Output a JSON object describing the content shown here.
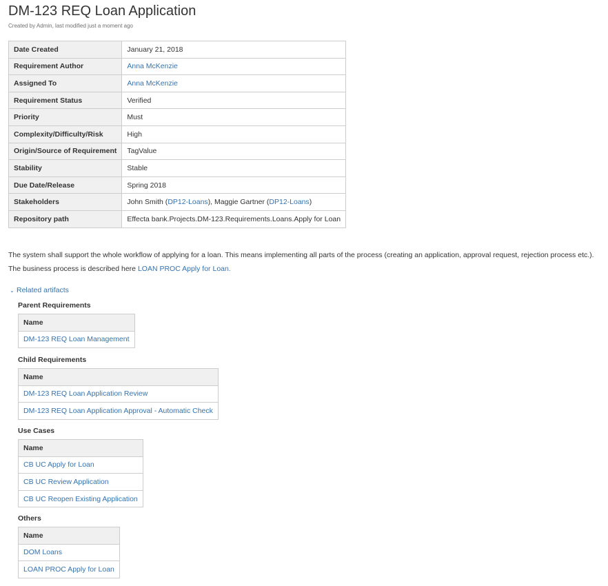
{
  "page": {
    "title": "DM-123 REQ Loan Application",
    "byline": "Created by Admin, last modified just a moment ago"
  },
  "properties": [
    {
      "label": "Date Created",
      "value": "January 21, 2018"
    },
    {
      "label": "Requirement Author",
      "value": "Anna McKenzie"
    },
    {
      "label": "Assigned To",
      "value": "Anna McKenzie"
    },
    {
      "label": "Requirement Status",
      "value": "Verified"
    },
    {
      "label": "Priority",
      "value": "Must"
    },
    {
      "label": "Complexity/Difficulty/Risk",
      "value": "High"
    },
    {
      "label": "Origin/Source of Requirement",
      "value": "TagValue"
    },
    {
      "label": "Stability",
      "value": "Stable"
    },
    {
      "label": "Due Date/Release",
      "value": "Spring 2018"
    },
    {
      "label": "Stakeholders",
      "value": ""
    },
    {
      "label": "Repository path",
      "value": "Effecta bank.Projects.DM-123.Requirements.Loans.Apply for Loan"
    }
  ],
  "stakeholders": {
    "person1": "John Smith",
    "person1_group": "DP12-Loans",
    "person2": "Maggie Gartner",
    "person2_group": "DP12-Loans"
  },
  "description": {
    "line1": "The system shall support the whole workflow of applying for a loan. This means implementing all parts of the process (creating an application, approval request, rejection process etc.).",
    "line2_prefix": "The business process is described here",
    "line2_link": "LOAN PROC Apply for Loan."
  },
  "related": {
    "toggle_label": "Related artifacts",
    "column_header": "Name",
    "sections": [
      {
        "title": "Parent Requirements",
        "items": [
          "DM-123 REQ Loan Management"
        ]
      },
      {
        "title": "Child Requirements",
        "items": [
          "DM-123 REQ Loan Application Review",
          "DM-123 REQ Loan Application Approval - Automatic Check"
        ]
      },
      {
        "title": "Use Cases",
        "items": [
          "CB UC Apply for Loan",
          "CB UC Review Application",
          "CB UC Reopen Existing Application"
        ]
      },
      {
        "title": "Others",
        "items": [
          "DOM Loans",
          "LOAN PROC Apply for Loan"
        ]
      }
    ]
  },
  "colors": {
    "link": "#3572b0",
    "header_bg": "#f0f0f0",
    "border": "#cccccc"
  }
}
